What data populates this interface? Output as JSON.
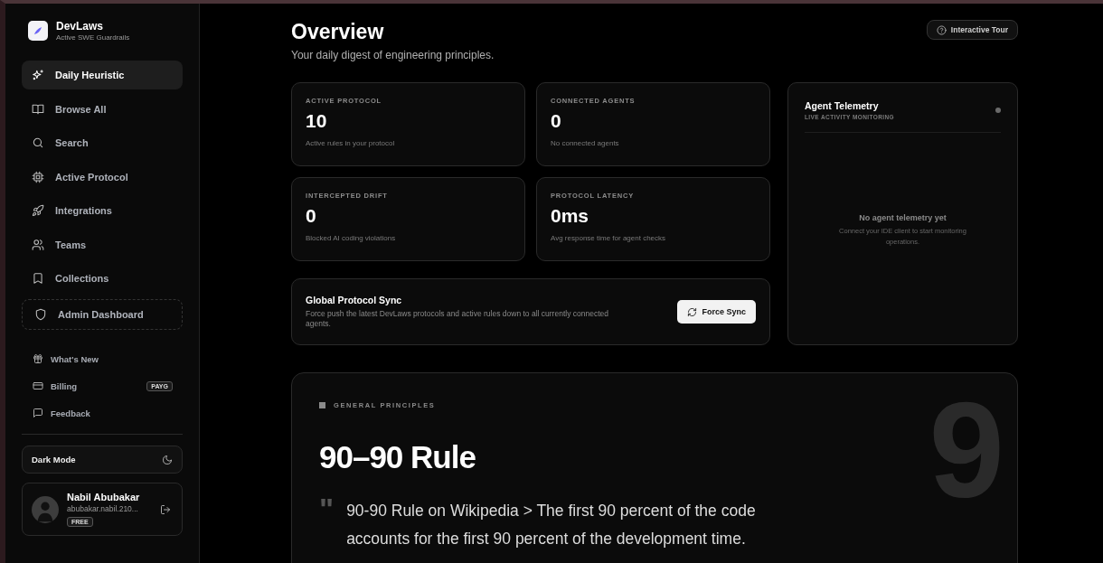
{
  "brand": {
    "name": "DevLaws",
    "tagline": "Active SWE Guardrails"
  },
  "nav": [
    {
      "label": "Daily Heuristic",
      "selected": true
    },
    {
      "label": "Browse All",
      "selected": false
    },
    {
      "label": "Search",
      "selected": false
    },
    {
      "label": "Active Protocol",
      "selected": false
    },
    {
      "label": "Integrations",
      "selected": false
    },
    {
      "label": "Teams",
      "selected": false
    },
    {
      "label": "Collections",
      "selected": false
    }
  ],
  "admin": {
    "label": "Admin Dashboard"
  },
  "secondary_nav": [
    {
      "label": "What's New"
    },
    {
      "label": "Billing",
      "badge": "PAYG"
    },
    {
      "label": "Feedback"
    }
  ],
  "theme": {
    "label": "Dark Mode"
  },
  "user": {
    "name": "Nabil Abubakar",
    "email": "abubakar.nabil.210...",
    "plan": "FREE"
  },
  "header": {
    "title": "Overview",
    "subtitle": "Your daily digest of engineering principles.",
    "tour_button": "Interactive Tour"
  },
  "stats": [
    {
      "label": "ACTIVE PROTOCOL",
      "value": "10",
      "caption": "Active rules in your protocol"
    },
    {
      "label": "CONNECTED AGENTS",
      "value": "0",
      "caption": "No connected agents"
    },
    {
      "label": "INTERCEPTED DRIFT",
      "value": "0",
      "caption": "Blocked AI coding violations"
    },
    {
      "label": "PROTOCOL LATENCY",
      "value": "0ms",
      "caption": "Avg response time for agent checks"
    }
  ],
  "sync": {
    "title": "Global Protocol Sync",
    "description": "Force push the latest DevLaws protocols and active rules down to all currently connected agents.",
    "button": "Force Sync"
  },
  "telemetry": {
    "title": "Agent Telemetry",
    "subtitle": "LIVE ACTIVITY MONITORING",
    "empty_title": "No agent telemetry yet",
    "empty_text": "Connect your IDE client to start monitoring operations."
  },
  "principle": {
    "category": "GENERAL PRINCIPLES",
    "title": "90–90 Rule",
    "backdrop_number": "9",
    "quote_mark": "\"",
    "quote": "90-90 Rule on Wikipedia > The first 90 percent of the code accounts for the first 90 percent of the development time."
  }
}
